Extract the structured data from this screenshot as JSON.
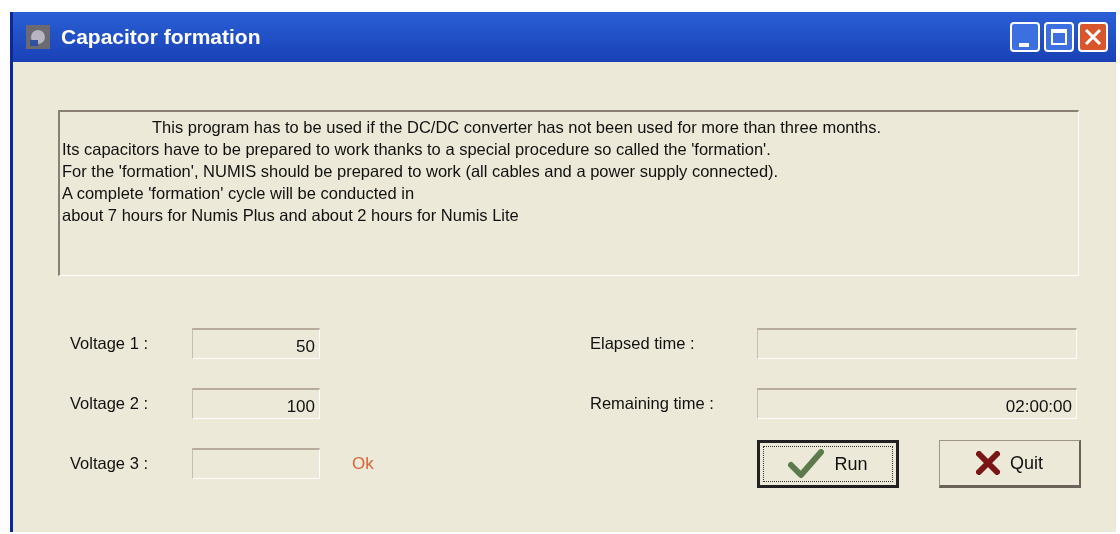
{
  "window": {
    "title": "Capacitor formation"
  },
  "description": [
    "This program has to be used if the DC/DC converter has not been used for more than three months.",
    "Its capacitors have to be prepared to work thanks to a special procedure so called the 'formation'.",
    "For the 'formation', NUMIS should be prepared to work (all cables and a power supply connected).",
    "A complete 'formation' cycle will be conducted in",
    "about 7 hours for Numis Plus and about 2 hours for Numis Lite"
  ],
  "voltages": [
    {
      "label": "Voltage 1 :",
      "value": "50"
    },
    {
      "label": "Voltage 2 :",
      "value": "100"
    },
    {
      "label": "Voltage 3 :",
      "status": "Ok"
    }
  ],
  "times": [
    {
      "label": "Elapsed time :"
    },
    {
      "label": "Remaining time :",
      "value": "02:00:00"
    }
  ],
  "buttons": [
    {
      "label": "Run",
      "kind": "check",
      "default": true
    },
    {
      "label": "Quit",
      "kind": "cross",
      "default": false
    }
  ]
}
